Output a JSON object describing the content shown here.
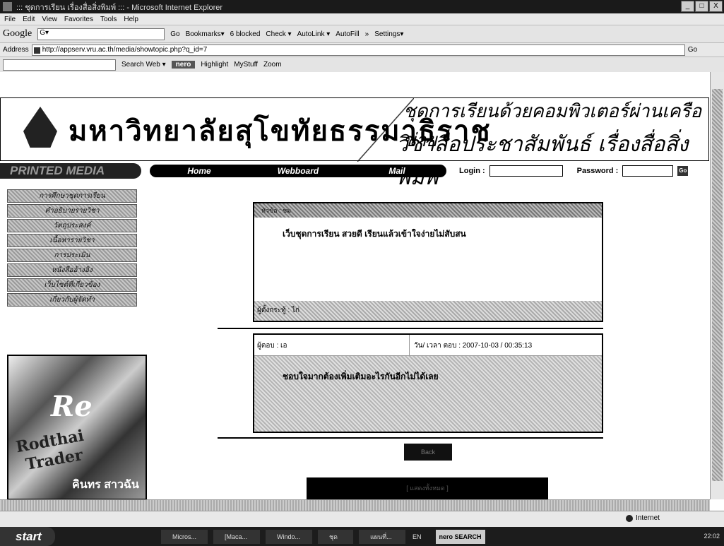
{
  "window": {
    "title": ":::  ชุดการเรียน  เรื่องสื่อสิ่งพิมพ์ :::  -  Microsoft Internet Explorer",
    "buttons": [
      "_",
      "□",
      "X"
    ]
  },
  "menu": [
    "File",
    "Edit",
    "View",
    "Favorites",
    "Tools",
    "Help"
  ],
  "google_toolbar": {
    "label": "Google",
    "search_value": "G▾",
    "items": [
      "Go",
      "Bookmarks▾",
      "6 blocked",
      "Check ▾",
      "AutoLink ▾",
      "AutoFill",
      "»",
      "Settings▾"
    ]
  },
  "address": {
    "label": "Address",
    "url": "http://appserv.vru.ac.th/media/showtopic.php?q_id=7",
    "go": "Go"
  },
  "ask_toolbar": {
    "items": [
      "Search Web ▾",
      "nero",
      "Highlight",
      "MyStuff",
      "Zoom"
    ]
  },
  "banner": {
    "university": "มหาวิทยาลัยสุโขทัยธรรมาธิราช",
    "tagline_1": "ชุดการเรียนด้วยคอมพิวเตอร์ผ่านเครือข่าย",
    "tagline_2": "วิชาสื่อประชาสัมพันธ์ เรื่องสื่อสิ่งพิมพ์"
  },
  "nav": {
    "brand": "PRINTED MEDIA",
    "links": [
      "Home",
      "Webboard",
      "Mail"
    ],
    "login_label": "Login :",
    "password_label": "Password :",
    "go_label": "Go"
  },
  "sidebar": {
    "items": [
      "การศึกษาชุดการเรียน",
      "คำอธิบายรายวิชา",
      "วัตถุประสงค์",
      "เนื้อหารายวิชา",
      "การประเมิน",
      "หนังสืออ้างอิง",
      "เว็บไซต์ที่เกี่ยวข้อง",
      "เกี่ยวกับผู้จัดทำ"
    ],
    "image_text": [
      "Rodthai",
      "Trader",
      "Re",
      "คินทร สาวฉันม"
    ]
  },
  "topic": {
    "header": "หัวข้อ : ชม",
    "body": "เว็บชุดการเรียน สวยดี เรียนแล้วเข้าใจง่ายไม่สับสน",
    "footer": "ผู้ตั้งกระทู้ : ไก่"
  },
  "reply": {
    "author": "ผู้ตอบ : เอ",
    "datetime": "วัน/ เวลา ตอบ : 2007-10-03 / 00:35:13",
    "body": "ชอบใจมากต้องเพิ่มเติมอะไรกันอีกไม่ได้เลย"
  },
  "buttons": {
    "back": "Back",
    "bottom": "[ แสดงทั้งหมด ]"
  },
  "statusbar": {
    "zone": "Internet"
  },
  "taskbar": {
    "start": "start",
    "tasks": [
      "Micros...",
      "[Maca...",
      "Windo...",
      "ชุด",
      "แผนที่...",
      "EN"
    ],
    "nero": "nero SEARCH",
    "clock": "22:02"
  }
}
